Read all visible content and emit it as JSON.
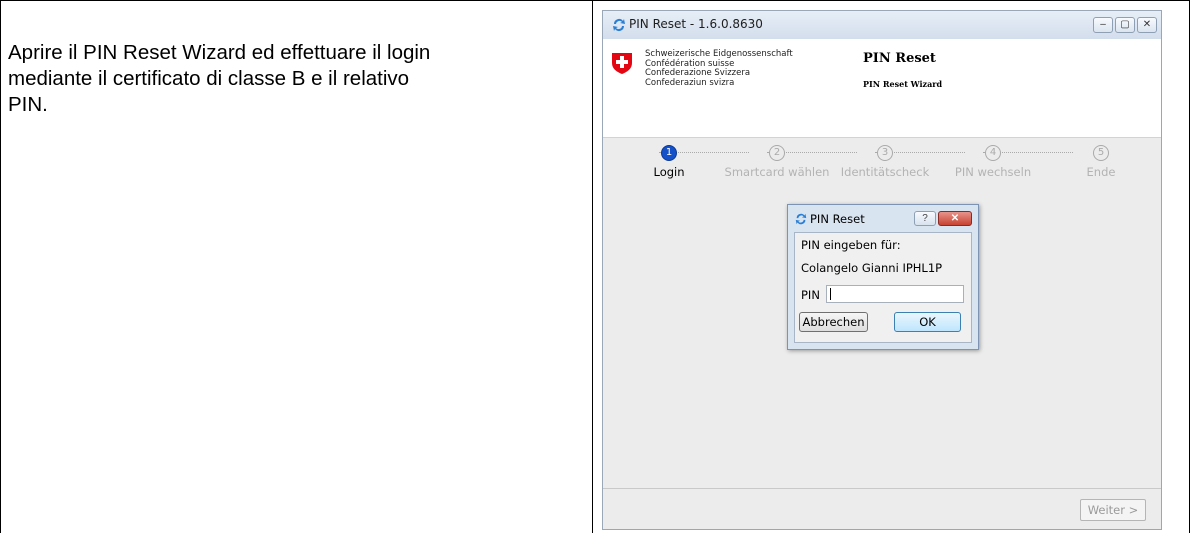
{
  "instruction": {
    "line1": "Aprire il PIN Reset Wizard ed effettuare il login",
    "line2": "mediante il certificato di classe B e il relativo",
    "line3": "PIN."
  },
  "window": {
    "title": "PIN Reset - 1.6.0.8630",
    "controls": {
      "minimize": "–",
      "maximize": "▢",
      "close": "✕"
    }
  },
  "header": {
    "confederation_lines": [
      "Schweizerische Eidgenossenschaft",
      "Confédération suisse",
      "Confederazione Svizzera",
      "Confederaziun svizra"
    ],
    "title": "PIN Reset",
    "subtitle": "PIN Reset Wizard"
  },
  "stepper": {
    "active_index": 0,
    "steps": [
      {
        "number": "1",
        "label": "Login"
      },
      {
        "number": "2",
        "label": "Smartcard wählen"
      },
      {
        "number": "3",
        "label": "Identitätscheck"
      },
      {
        "number": "4",
        "label": "PIN wechseln"
      },
      {
        "number": "5",
        "label": "Ende"
      }
    ]
  },
  "dialog": {
    "title": "PIN Reset",
    "help": "?",
    "close": "✕",
    "prompt": "PIN eingeben für:",
    "user": "Colangelo Gianni IPHL1P",
    "pin_label": "PIN",
    "pin_value": "",
    "cancel_label": "Abbrechen",
    "ok_label": "OK"
  },
  "footer": {
    "next_label": "Weiter >"
  },
  "colors": {
    "step_active": "#1450c8",
    "swiss_red": "#e30613"
  }
}
